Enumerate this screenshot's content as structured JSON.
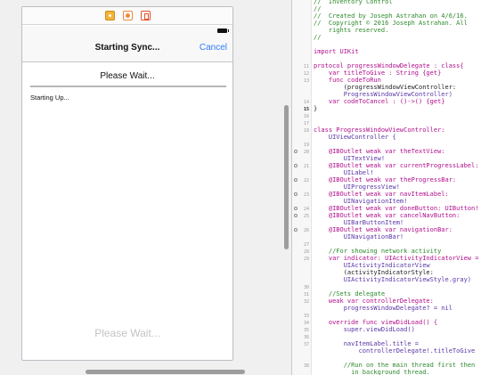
{
  "storyboard": {
    "dock_icons": [
      "view-controller-icon",
      "first-responder-icon",
      "exit-icon"
    ],
    "nav_title": "Starting Sync...",
    "nav_cancel": "Cancel",
    "progress_label": "Please Wait...",
    "status_text": "Starting Up...",
    "placeholder_label": "Please Wait..."
  },
  "editor": {
    "lines": [
      {
        "num": "",
        "text": "//  Inventory Control",
        "kind": "comment"
      },
      {
        "num": "",
        "text": "//",
        "kind": "comment"
      },
      {
        "num": "",
        "text": "//  Created by Joseph Astrahan on 4/6/16.",
        "kind": "comment"
      },
      {
        "num": "",
        "text": "//  Copyright © 2016 Joseph Astrahan. All",
        "kind": "comment"
      },
      {
        "num": "",
        "text": "    rights reserved.",
        "kind": "comment"
      },
      {
        "num": "",
        "text": "//",
        "kind": "comment"
      },
      {
        "num": "",
        "text": "",
        "kind": "plain"
      },
      {
        "num": "",
        "text": "import UIKit",
        "kind": "keyword"
      },
      {
        "num": "",
        "text": "",
        "kind": "plain"
      },
      {
        "num": "11",
        "text": "protocol progressWindowDelegate : class{",
        "kind": "keyword"
      },
      {
        "num": "12",
        "text": "    var titleToGive : String {get}",
        "kind": "keyword"
      },
      {
        "num": "13",
        "text": "    func codeToRun",
        "kind": "keyword"
      },
      {
        "num": "",
        "text": "        (progressWindowViewController:",
        "kind": "plain"
      },
      {
        "num": "",
        "text": "        ProgressWindowViewController)",
        "kind": "type"
      },
      {
        "num": "14",
        "text": "    var codeToCancel : ()->() {get}",
        "kind": "keyword"
      },
      {
        "num": "15",
        "text": "}",
        "kind": "plain",
        "current": true
      },
      {
        "num": "16",
        "text": "",
        "kind": "plain"
      },
      {
        "num": "17",
        "text": "",
        "kind": "plain"
      },
      {
        "num": "18",
        "text": "class ProgressWindowViewController:",
        "kind": "keyword"
      },
      {
        "num": "",
        "text": "    UIViewController {",
        "kind": "type"
      },
      {
        "num": "19",
        "text": "",
        "kind": "plain"
      },
      {
        "num": "20",
        "text": "    @IBOutlet weak var theTextView:",
        "kind": "keyword",
        "outlet": true
      },
      {
        "num": "",
        "text": "        UITextView!",
        "kind": "type"
      },
      {
        "num": "21",
        "text": "    @IBOutlet weak var currentProgressLabel:",
        "kind": "keyword",
        "outlet": true
      },
      {
        "num": "",
        "text": "        UILabel!",
        "kind": "type"
      },
      {
        "num": "22",
        "text": "    @IBOutlet weak var theProgressBar:",
        "kind": "keyword",
        "outlet": true
      },
      {
        "num": "",
        "text": "        UIProgressView!",
        "kind": "type"
      },
      {
        "num": "23",
        "text": "    @IBOutlet weak var navItemLabel:",
        "kind": "keyword",
        "outlet": true
      },
      {
        "num": "",
        "text": "        UINavigationItem!",
        "kind": "type"
      },
      {
        "num": "24",
        "text": "    @IBOutlet weak var doneButton: UIButton!",
        "kind": "keyword",
        "outlet": true
      },
      {
        "num": "25",
        "text": "    @IBOutlet weak var cancelNavButton:",
        "kind": "keyword",
        "outlet": true
      },
      {
        "num": "",
        "text": "        UIBarButtonItem!",
        "kind": "type"
      },
      {
        "num": "26",
        "text": "    @IBOutlet weak var navigationBar:",
        "kind": "keyword",
        "outlet": true
      },
      {
        "num": "",
        "text": "        UINavigationBar!",
        "kind": "type"
      },
      {
        "num": "27",
        "text": "",
        "kind": "plain"
      },
      {
        "num": "28",
        "text": "    //For showing network activity",
        "kind": "comment"
      },
      {
        "num": "29",
        "text": "    var indicator: UIActivityIndicatorView =",
        "kind": "keyword"
      },
      {
        "num": "",
        "text": "        UIActivityIndicatorView",
        "kind": "type"
      },
      {
        "num": "",
        "text": "        (activityIndicatorStyle:",
        "kind": "plain"
      },
      {
        "num": "",
        "text": "        UIActivityIndicatorViewStyle.gray)",
        "kind": "type"
      },
      {
        "num": "30",
        "text": "",
        "kind": "plain"
      },
      {
        "num": "31",
        "text": "    //Sets delegate",
        "kind": "comment"
      },
      {
        "num": "32",
        "text": "    weak var controllerDelegate:",
        "kind": "keyword"
      },
      {
        "num": "",
        "text": "        progressWindowDelegate? = nil",
        "kind": "type"
      },
      {
        "num": "33",
        "text": "",
        "kind": "plain"
      },
      {
        "num": "34",
        "text": "    override func viewDidLoad() {",
        "kind": "keyword"
      },
      {
        "num": "35",
        "text": "        super.viewDidLoad()",
        "kind": "type"
      },
      {
        "num": "36",
        "text": "",
        "kind": "plain"
      },
      {
        "num": "37",
        "text": "        navItemLabel.title =",
        "kind": "type"
      },
      {
        "num": "",
        "text": "            controllerDelegate!.titleToGive",
        "kind": "type"
      },
      {
        "num": "",
        "text": "",
        "kind": "plain"
      },
      {
        "num": "38",
        "text": "        //Run on the main thread first then",
        "kind": "comment"
      },
      {
        "num": "",
        "text": "          in background thread.",
        "kind": "comment"
      }
    ]
  }
}
